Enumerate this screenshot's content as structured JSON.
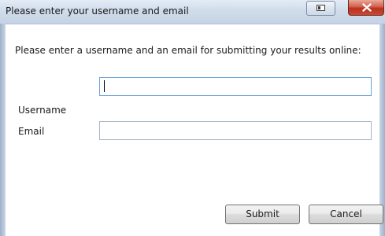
{
  "window": {
    "title": "Please enter your username and email"
  },
  "dialog": {
    "instruction": "Please enter a username and an email for submitting your results online:",
    "username_label": "Username",
    "username_value": "",
    "email_label": "Email",
    "email_value": "",
    "submit_label": "Submit",
    "cancel_label": "Cancel"
  },
  "icons": {
    "restore": "restore-icon",
    "close": "close-icon"
  },
  "colors": {
    "titlebar": "#d0dcea",
    "close_button": "#c84a33",
    "focused_border": "#6ea4d8"
  }
}
